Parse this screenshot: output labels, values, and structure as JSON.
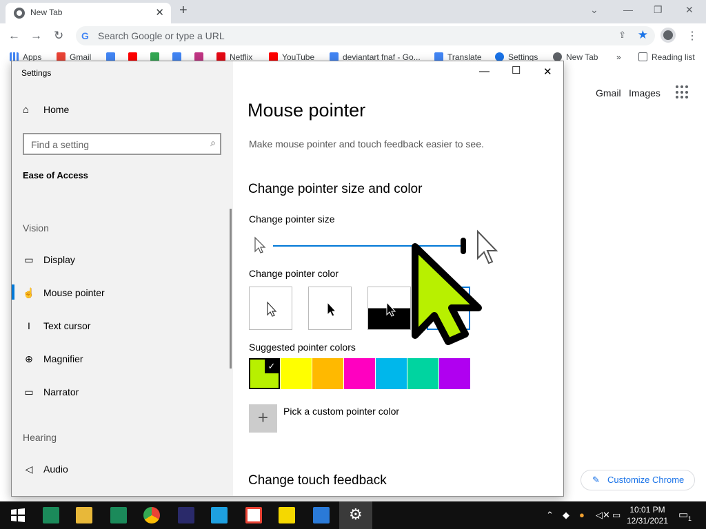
{
  "browser": {
    "tab_title": "New Tab",
    "omnibox_placeholder": "Search Google or type a URL",
    "bookmarks": [
      "Apps",
      "Gmail",
      "",
      "",
      "",
      "",
      "Netflix",
      "YouTube",
      "deviantart fnaf - Go...",
      "Translate",
      "Settings",
      "New Tab"
    ],
    "more_bookmarks": "»",
    "reading_list": "Reading list",
    "gmail_link": "Gmail",
    "images_link": "Images",
    "customize_label": "Customize Chrome"
  },
  "settings_window": {
    "title": "Settings",
    "home_label": "Home",
    "search_placeholder": "Find a setting",
    "section": "Ease of Access",
    "categories": {
      "vision": "Vision",
      "hearing": "Hearing"
    },
    "nav": {
      "display": "Display",
      "mouse_pointer": "Mouse pointer",
      "text_cursor": "Text cursor",
      "magnifier": "Magnifier",
      "narrator": "Narrator",
      "audio": "Audio"
    },
    "content": {
      "page_title": "Mouse pointer",
      "subtitle": "Make mouse pointer and touch feedback easier to see.",
      "heading_size_color": "Change pointer size and color",
      "label_size": "Change pointer size",
      "pointer_size_level": 1.0,
      "label_color": "Change pointer color",
      "label_suggested": "Suggested pointer colors",
      "suggested_colors": [
        "#b8f000",
        "#ffff00",
        "#ffb900",
        "#ff00c0",
        "#00b7eb",
        "#00d4a0",
        "#b000f0"
      ],
      "selected_color": "#b8f000",
      "label_custom": "Pick a custom pointer color",
      "heading_touch": "Change touch feedback"
    }
  },
  "taskbar": {
    "clock_time": "10:01 PM",
    "clock_date": "12/31/2021",
    "notifications": "1"
  }
}
